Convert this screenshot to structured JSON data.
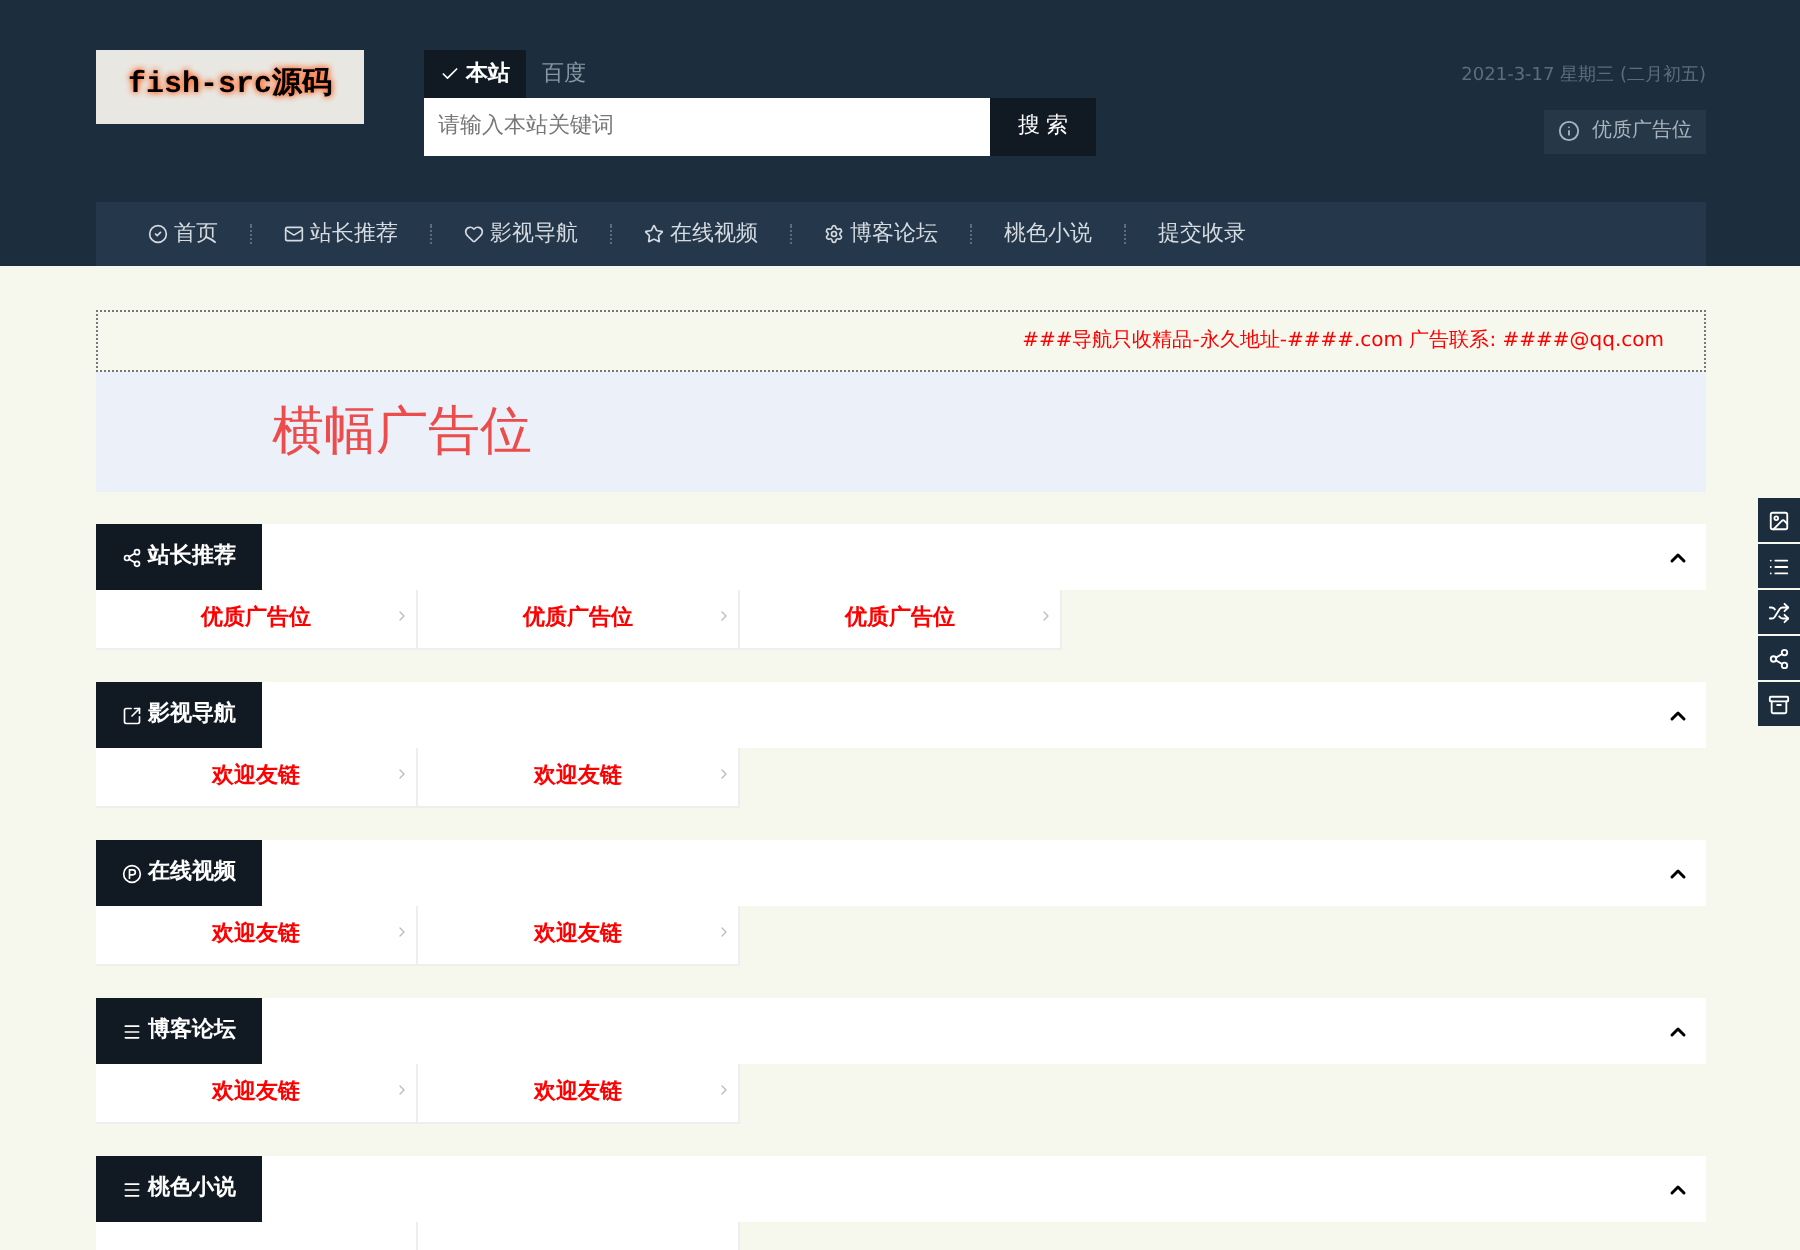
{
  "logo": {
    "text": "fish-src源码"
  },
  "search": {
    "engines": [
      {
        "label": "本站",
        "selected": true
      },
      {
        "label": "百度",
        "selected": false
      }
    ],
    "placeholder": "请输入本站关键词",
    "button": "搜 索"
  },
  "date": "2021-3-17 星期三 (二月初五)",
  "ad_button": "优质广告位",
  "nav": [
    {
      "label": "首页"
    },
    {
      "label": "站长推荐"
    },
    {
      "label": "影视导航"
    },
    {
      "label": "在线视频"
    },
    {
      "label": "博客论坛"
    },
    {
      "label": "桃色小说"
    },
    {
      "label": "提交收录"
    }
  ],
  "notice": "###导航只收精品-永久地址-####.com 广告联系: ####@qq.com",
  "banner": "横幅广告位",
  "sections": [
    {
      "title": "站长推荐",
      "expanded": true,
      "links": [
        "优质广告位",
        "优质广告位",
        "优质广告位"
      ]
    },
    {
      "title": "影视导航",
      "expanded": true,
      "links": [
        "欢迎友链",
        "欢迎友链"
      ]
    },
    {
      "title": "在线视频",
      "expanded": true,
      "links": [
        "欢迎友链",
        "欢迎友链"
      ]
    },
    {
      "title": "博客论坛",
      "expanded": true,
      "links": [
        "欢迎友链",
        "欢迎友链"
      ]
    },
    {
      "title": "桃色小说",
      "expanded": true
    }
  ]
}
